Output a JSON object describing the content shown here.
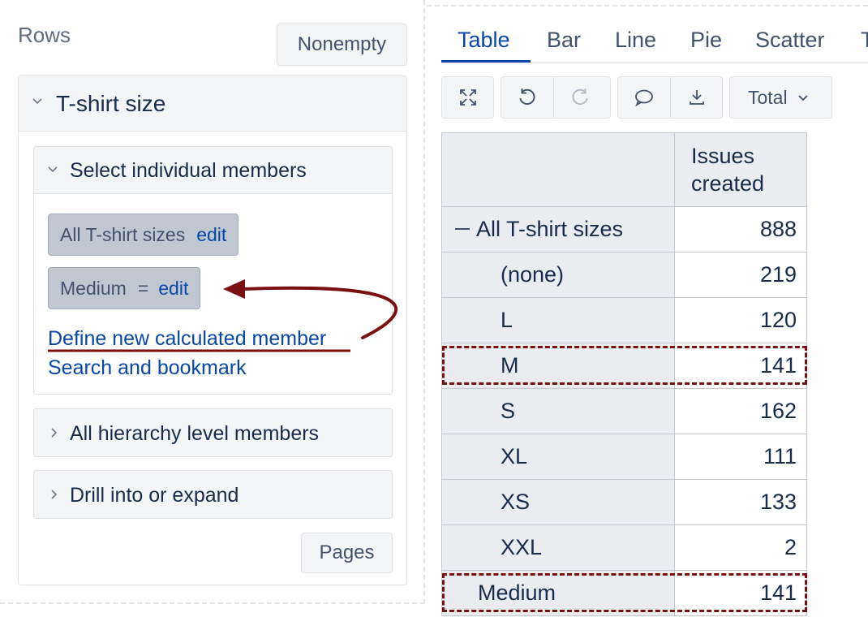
{
  "left_panel": {
    "rows_title": "Rows",
    "nonempty_button": "Nonempty",
    "dimension_card": {
      "title": "T-shirt size",
      "select_members": {
        "title": "Select individual members",
        "chips": [
          {
            "label": "All T-shirt sizes",
            "edit": "edit"
          },
          {
            "label": "Medium",
            "operator": "=",
            "edit": "edit"
          }
        ],
        "links": {
          "define_calculated": "Define new calculated member",
          "search_bookmark": "Search and bookmark"
        }
      },
      "all_hierarchy": "All hierarchy level members",
      "drill_into": "Drill into or expand",
      "pages_button": "Pages"
    }
  },
  "view_tabs": [
    "Table",
    "Bar",
    "Line",
    "Pie",
    "Scatter",
    "T"
  ],
  "active_tab": "Table",
  "toolbar": {
    "icons": [
      "expand-icon",
      "undo-icon",
      "redo-icon",
      "comment-icon",
      "download-icon"
    ],
    "total_dropdown": "Total"
  },
  "table": {
    "column_header": [
      "Issues",
      "created"
    ],
    "rows": [
      {
        "label": "All T-shirt sizes",
        "value": "888"
      },
      {
        "label": "(none)",
        "value": "219"
      },
      {
        "label": "L",
        "value": "120"
      },
      {
        "label": "M",
        "value": "141"
      },
      {
        "label": "S",
        "value": "162"
      },
      {
        "label": "XL",
        "value": "111"
      },
      {
        "label": "XS",
        "value": "133"
      },
      {
        "label": "XXL",
        "value": "2"
      },
      {
        "label": "Medium",
        "value": "141"
      }
    ]
  },
  "colors": {
    "link": "#0747a6",
    "annotation": "#7a1010",
    "chip_bg": "#c1c7d0",
    "header_bg": "#ebecf0"
  }
}
